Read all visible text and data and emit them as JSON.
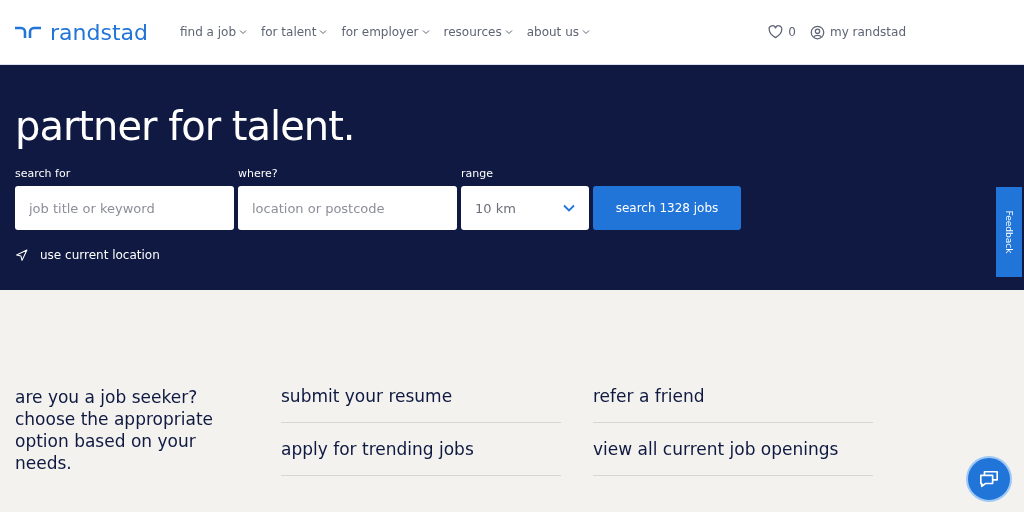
{
  "header": {
    "logo": "randstad",
    "nav": [
      {
        "label": "find a job"
      },
      {
        "label": "for talent"
      },
      {
        "label": "for employer"
      },
      {
        "label": "resources"
      },
      {
        "label": "about us"
      }
    ],
    "favorites_count": "0",
    "account": "my randstad"
  },
  "hero": {
    "title": "partner for talent.",
    "fields": [
      {
        "kind": "text",
        "label": "search for",
        "placeholder": "job title or keyword"
      },
      {
        "kind": "text",
        "label": "where?",
        "placeholder": "location or postcode"
      },
      {
        "kind": "select",
        "label": "range",
        "value": "10 km"
      }
    ],
    "search_button": "search 1328 jobs",
    "location_link": "use current location"
  },
  "feedback_tab": "Feedback",
  "options": {
    "intro": "are you a job seeker? choose the appropriate option based on your needs.",
    "columns": [
      [
        "submit your resume",
        "apply for trending jobs"
      ],
      [
        "refer a friend",
        "view all current job openings"
      ]
    ]
  }
}
